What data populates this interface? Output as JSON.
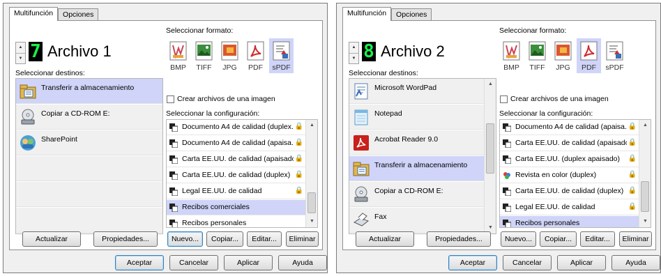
{
  "windows": [
    {
      "tabs": [
        "Multifunción",
        "Opciones"
      ],
      "lcd_number": "7",
      "process_name": "Archivo 1",
      "select_format_label": "Seleccionar formato:",
      "formats": [
        {
          "label": "BMP",
          "icon": "bmp-icon",
          "selected": false
        },
        {
          "label": "TIFF",
          "icon": "tiff-icon",
          "selected": false
        },
        {
          "label": "JPG",
          "icon": "jpg-icon",
          "selected": false
        },
        {
          "label": "PDF",
          "icon": "pdf-icon",
          "selected": false
        },
        {
          "label": "sPDF",
          "icon": "spdf-icon",
          "selected": true
        }
      ],
      "single_image_label": "Crear archivos de una imagen",
      "select_destinations_label": "Seleccionar destinos:",
      "destinations": [
        {
          "label": "Transferir a almacenamiento",
          "icon": "storage-icon",
          "selected": true
        },
        {
          "label": "Copiar a CD-ROM  E:",
          "icon": "cdrom-icon",
          "selected": false
        },
        {
          "label": "SharePoint",
          "icon": "sharepoint-icon",
          "selected": false
        },
        {
          "label": "",
          "icon": "",
          "selected": false
        },
        {
          "label": "",
          "icon": "",
          "selected": false
        },
        {
          "label": "",
          "icon": "",
          "selected": false
        }
      ],
      "select_config_label": "Seleccionar la configuración:",
      "configs": [
        {
          "label": "Documento A4 de calidad (duplex...",
          "locked": true,
          "selected": false
        },
        {
          "label": "Documento A4 de calidad (apaisa...",
          "locked": true,
          "selected": false
        },
        {
          "label": "Carta EE.UU. de calidad (apaisado)",
          "locked": true,
          "selected": false
        },
        {
          "label": "Carta EE.UU. de calidad (duplex)",
          "locked": true,
          "selected": false
        },
        {
          "label": "Legal EE.UU. de calidad",
          "locked": true,
          "selected": false
        },
        {
          "label": "Recibos comerciales",
          "locked": false,
          "selected": true
        },
        {
          "label": "Recibos personales",
          "locked": false,
          "selected": false
        }
      ],
      "buttons": {
        "update": "Actualizar",
        "properties": "Propiedades...",
        "new": "Nuevo...",
        "copy": "Copiar...",
        "edit": "Editar...",
        "delete": "Eliminar"
      },
      "footer": {
        "ok": "Aceptar",
        "cancel": "Cancelar",
        "apply": "Aplicar",
        "help": "Ayuda"
      }
    },
    {
      "tabs": [
        "Multifunción",
        "Opciones"
      ],
      "lcd_number": "8",
      "process_name": "Archivo 2",
      "select_format_label": "Seleccionar formato:",
      "formats": [
        {
          "label": "BMP",
          "icon": "bmp-icon",
          "selected": false
        },
        {
          "label": "TIFF",
          "icon": "tiff-icon",
          "selected": false
        },
        {
          "label": "JPG",
          "icon": "jpg-icon",
          "selected": false
        },
        {
          "label": "PDF",
          "icon": "pdf-icon",
          "selected": true
        },
        {
          "label": "sPDF",
          "icon": "spdf-icon",
          "selected": false
        }
      ],
      "single_image_label": "Crear archivos de una imagen",
      "select_destinations_label": "Seleccionar destinos:",
      "destinations": [
        {
          "label": "Microsoft WordPad",
          "icon": "wordpad-icon",
          "selected": false
        },
        {
          "label": "Notepad",
          "icon": "notepad-icon",
          "selected": false
        },
        {
          "label": "Acrobat Reader 9.0",
          "icon": "acrobat-icon",
          "selected": false
        },
        {
          "label": "Transferir a almacenamiento",
          "icon": "storage-icon",
          "selected": true
        },
        {
          "label": "Copiar a CD-ROM  E:",
          "icon": "cdrom-icon",
          "selected": false
        },
        {
          "label": "Fax",
          "icon": "fax-icon",
          "selected": false
        }
      ],
      "select_config_label": "Seleccionar la configuración:",
      "configs": [
        {
          "label": "Documento A4 de calidad (apaisa...",
          "locked": true,
          "selected": false
        },
        {
          "label": "Carta EE.UU. de calidad (apaisado)",
          "locked": true,
          "selected": false
        },
        {
          "label": "Carta EE.UU. (duplex apaisado)",
          "locked": true,
          "selected": false
        },
        {
          "label": "Revista en color (duplex)",
          "locked": true,
          "selected": false
        },
        {
          "label": "Carta EE.UU. de calidad (duplex)",
          "locked": true,
          "selected": false
        },
        {
          "label": "Legal EE.UU. de calidad",
          "locked": true,
          "selected": false
        },
        {
          "label": "Recibos personales",
          "locked": false,
          "selected": true
        }
      ],
      "buttons": {
        "update": "Actualizar",
        "properties": "Propiedades...",
        "new": "Nuevo...",
        "copy": "Copiar...",
        "edit": "Editar...",
        "delete": "Eliminar"
      },
      "footer": {
        "ok": "Aceptar",
        "cancel": "Cancelar",
        "apply": "Aplicar",
        "help": "Ayuda"
      }
    }
  ],
  "colors": {
    "selection": "#cfd4f8",
    "lcd_background": "#000000",
    "lcd_digit": "#17f24c"
  }
}
